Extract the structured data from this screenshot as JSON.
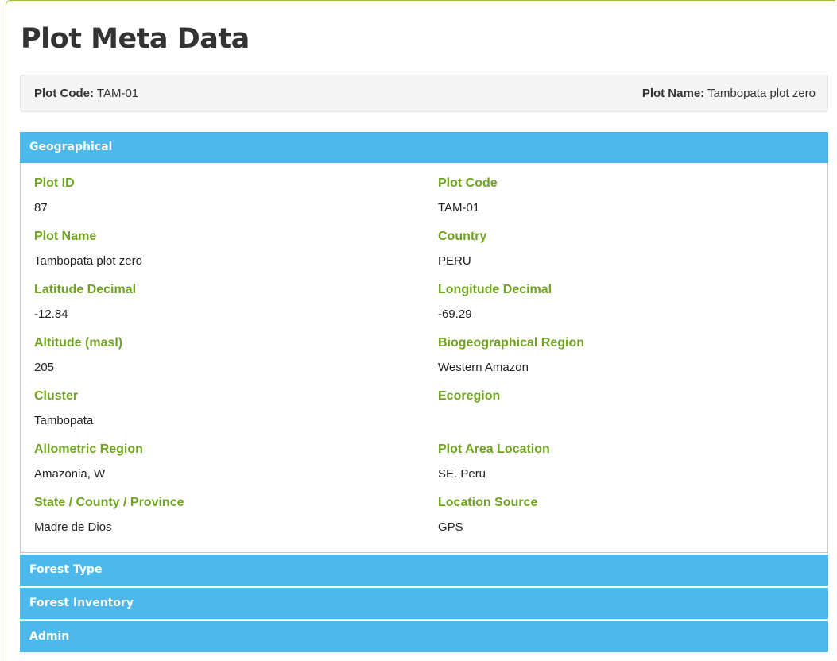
{
  "page": {
    "title": "Plot Meta Data"
  },
  "meta_bar": {
    "plot_code_label": "Plot Code:",
    "plot_code_value": "TAM-01",
    "plot_name_label": "Plot Name:",
    "plot_name_value": "Tambopata plot zero"
  },
  "sections": {
    "geographical": {
      "title": "Geographical",
      "fields": [
        {
          "label": "Plot ID",
          "value": "87"
        },
        {
          "label": "Plot Code",
          "value": "TAM-01"
        },
        {
          "label": "Plot Name",
          "value": "Tambopata plot zero"
        },
        {
          "label": "Country",
          "value": "PERU"
        },
        {
          "label": "Latitude Decimal",
          "value": "-12.84"
        },
        {
          "label": "Longitude Decimal",
          "value": "-69.29"
        },
        {
          "label": "Altitude (masl)",
          "value": "205"
        },
        {
          "label": "Biogeographical Region",
          "value": "Western Amazon"
        },
        {
          "label": "Cluster",
          "value": "Tambopata"
        },
        {
          "label": "Ecoregion",
          "value": ""
        },
        {
          "label": "Allometric Region",
          "value": "Amazonia, W"
        },
        {
          "label": "Plot Area Location",
          "value": "SE. Peru"
        },
        {
          "label": "State / County / Province",
          "value": "Madre de Dios"
        },
        {
          "label": "Location Source",
          "value": "GPS"
        }
      ]
    },
    "forest_type": {
      "title": "Forest Type"
    },
    "forest_inventory": {
      "title": "Forest Inventory"
    },
    "admin": {
      "title": "Admin"
    }
  },
  "colors": {
    "panel_heading": "#4db8ec",
    "label_green": "#6fa320",
    "frame_border": "#9cbf3b"
  }
}
